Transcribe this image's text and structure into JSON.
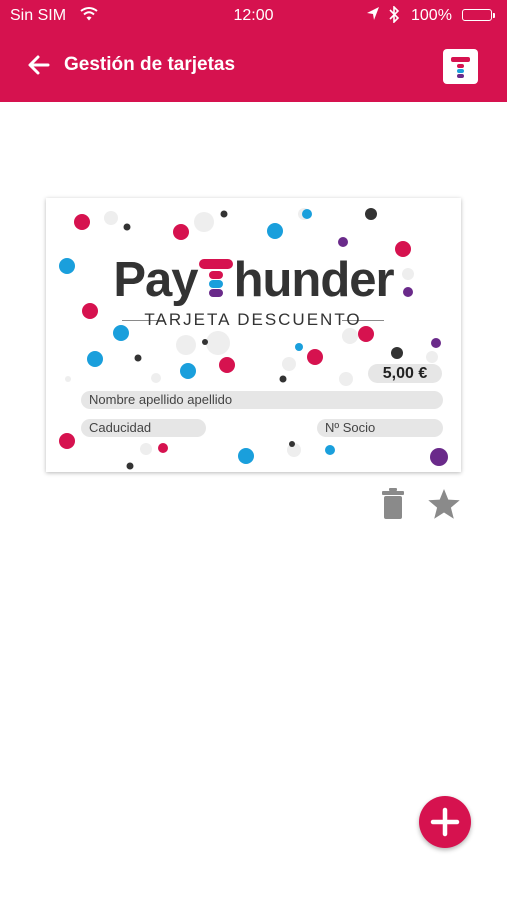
{
  "status_bar": {
    "carrier": "Sin SIM",
    "time": "12:00",
    "battery": "100%"
  },
  "header": {
    "title": "Gestión de tarjetas",
    "back_icon": "arrow-left-icon",
    "logo_icon": "paythunder-logo-icon"
  },
  "card": {
    "brand_prefix": "Pay",
    "brand_suffix": "hunder",
    "subtitle": "TARJETA DESCUENTO",
    "amount": "5,00 €",
    "name_placeholder": "Nombre apellido apellido",
    "expiry_placeholder": "Caducidad",
    "member_placeholder": "Nº Socio"
  },
  "actions": {
    "delete_icon": "trash-icon",
    "favorite_icon": "star-icon",
    "add_icon": "plus-icon"
  },
  "colors": {
    "primary": "#d6124f",
    "dot_blue": "#1a9fdc",
    "dot_purple": "#6a2a8a",
    "dot_dark": "#333333",
    "text_dark": "#333333",
    "icon_gray": "#8a8a8a"
  }
}
